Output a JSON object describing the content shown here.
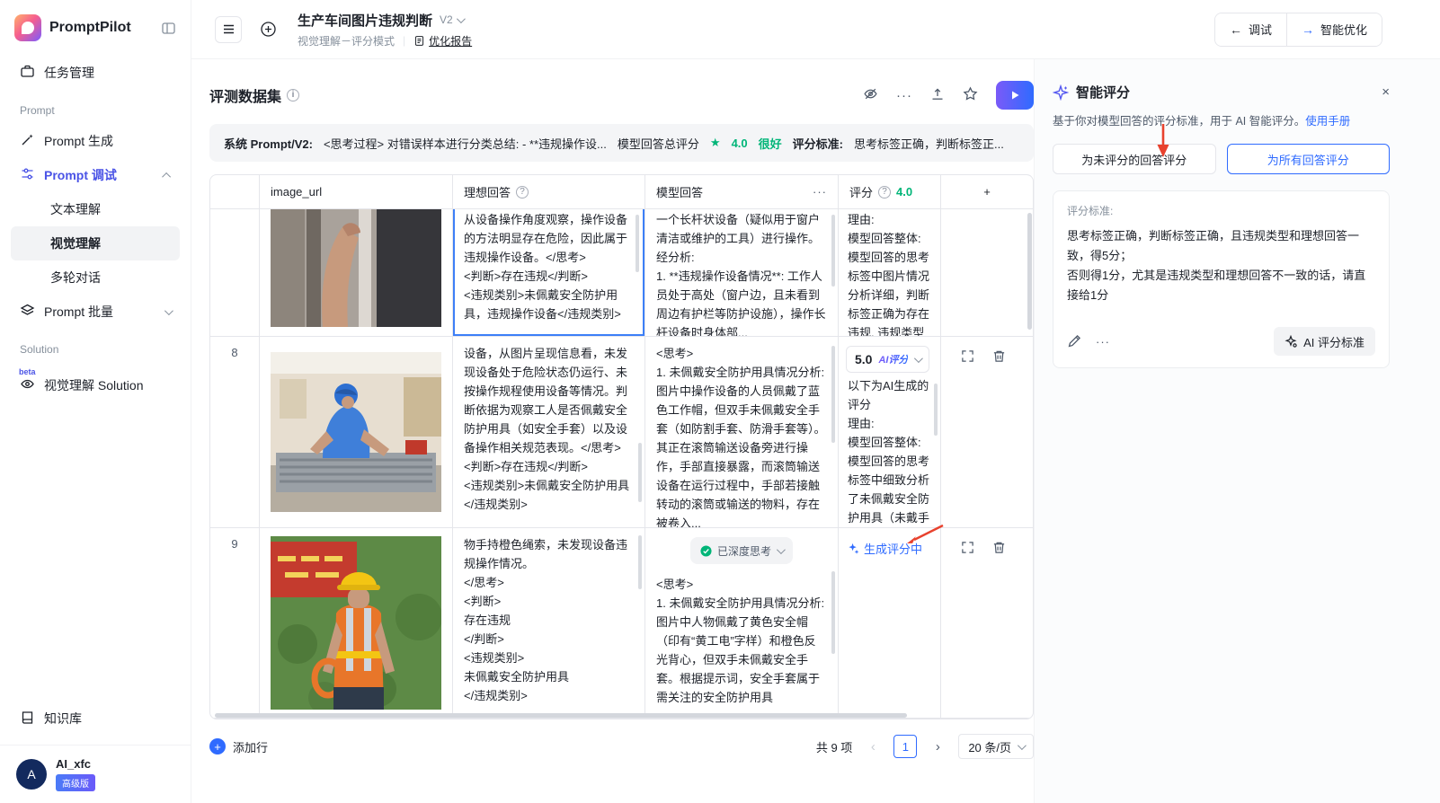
{
  "app": {
    "name": "PromptPilot"
  },
  "icons": {
    "more": "···",
    "plus": "+",
    "question": "?",
    "info": "i",
    "prev": "‹",
    "next": "›",
    "close": "×",
    "star": "★",
    "arrow_left": "←",
    "arrow_right": "→"
  },
  "sidebar": {
    "task": "任务管理",
    "section_prompt": "Prompt",
    "prompt_gen": "Prompt 生成",
    "prompt_debug": "Prompt 调试",
    "sub_text": "文本理解",
    "sub_vision": "视觉理解",
    "sub_multi": "多轮对话",
    "prompt_batch": "Prompt 批量",
    "section_solution": "Solution",
    "beta": "beta",
    "solution_vision": "视觉理解 Solution",
    "kb": "知识库",
    "user": {
      "avatar": "A",
      "name": "AI_xfc",
      "badge": "高级版"
    }
  },
  "topbar": {
    "title": "生产车间图片违规判断",
    "version": "V2",
    "mode": "视觉理解－评分模式",
    "report": "优化报告",
    "debug": "调试",
    "optimize": "智能优化"
  },
  "dataset": {
    "title": "评测数据集",
    "prompt_label": "系统 Prompt/V2:",
    "prompt_text": "<思考过程> 对错误样本进行分类总结: - **违规操作设...",
    "score_label": "模型回答总评分",
    "score": "4.0",
    "score_desc": "很好",
    "criteria_label": "评分标准:",
    "criteria_text": "思考标签正确，判断标签正..."
  },
  "table": {
    "col_image": "image_url",
    "col_ideal": "理想回答",
    "col_model": "模型回答",
    "col_score": "评分",
    "col_score_value": "4.0",
    "rows": [
      {
        "num": "",
        "ideal": "从设备操作角度观察，操作设备的方法明显存在危险，因此属于违规操作设备。</思考>\n<判断>存在违规</判断>\n<违规类别>未佩戴安全防护用具，违规操作设备</违规类别>",
        "model": "一个长杆状设备（疑似用于窗户清洁或维护的工具）进行操作。经分析:\n1. **违规操作设备情况**: 工作人员处于高处（窗户边，且未看到周边有护栏等防护设施），操作长杆设备时身体部...",
        "score_reason": "理由:\n模型回答整体: 模型回答的思考标签中图片情况分析详细，判断标签正确为存在违规, 违规类型与..."
      },
      {
        "num": "8",
        "ideal": "设备，从图片呈现信息看，未发现设备处于危险状态仍运行、未按操作规程使用设备等情况。判断依据为观察工人是否佩戴安全防护用具（如安全手套）以及设备操作相关规范表现。</思考>\n<判断>存在违规</判断>\n<违规类别>未佩戴安全防护用具</违规类别>",
        "model": "<思考>\n1. 未佩戴安全防护用具情况分析: 图片中操作设备的人员佩戴了蓝色工作帽，但双手未佩戴安全手套（如防割手套、防滑手套等）。其正在滚筒输送设备旁进行操作，手部直接暴露，而滚筒输送设备在运行过程中，手部若接触转动的滚筒或输送的物料，存在被卷入...",
        "score_value": "5.0",
        "score_badge": "AI评分",
        "score_reason": "以下为AI生成的评分\n理由:\n模型回答整体: 模型回答的思考标签中细致分析了未佩戴安全防护用具（未戴手套）的情况及风险..."
      },
      {
        "num": "9",
        "ideal": "物手持橙色绳索，未发现设备违规操作情况。\n</思考>\n<判断>\n存在违规\n</判断>\n<违规类别>\n未佩戴安全防护用具\n</违规类别>",
        "model_badge": "已深度思考",
        "model": "<思考>\n1. 未佩戴安全防护用具情况分析: 图片中人物佩戴了黄色安全帽（印有“黄工电”字样）和橙色反光背心，但双手未佩戴安全手套。根据提示词，安全手套属于需关注的安全防护用具",
        "score_status": "生成评分中"
      }
    ]
  },
  "pager": {
    "add_row": "添加行",
    "total": "共 9 项",
    "page": "1",
    "page_size": "20 条/页"
  },
  "panel": {
    "title": "智能评分",
    "desc": "基于你对模型回答的评分标准，用于 AI 智能评分。",
    "manual": "使用手册",
    "btn_unscored": "为未评分的回答评分",
    "btn_all": "为所有回答评分",
    "criteria_label": "评分标准:",
    "criteria_text": "思考标签正确，判断标签正确，且违规类型和理想回答一致，得5分；\n否则得1分，尤其是违规类型和理想回答不一致的话，请直接给1分",
    "ai_btn": "AI 评分标准"
  }
}
